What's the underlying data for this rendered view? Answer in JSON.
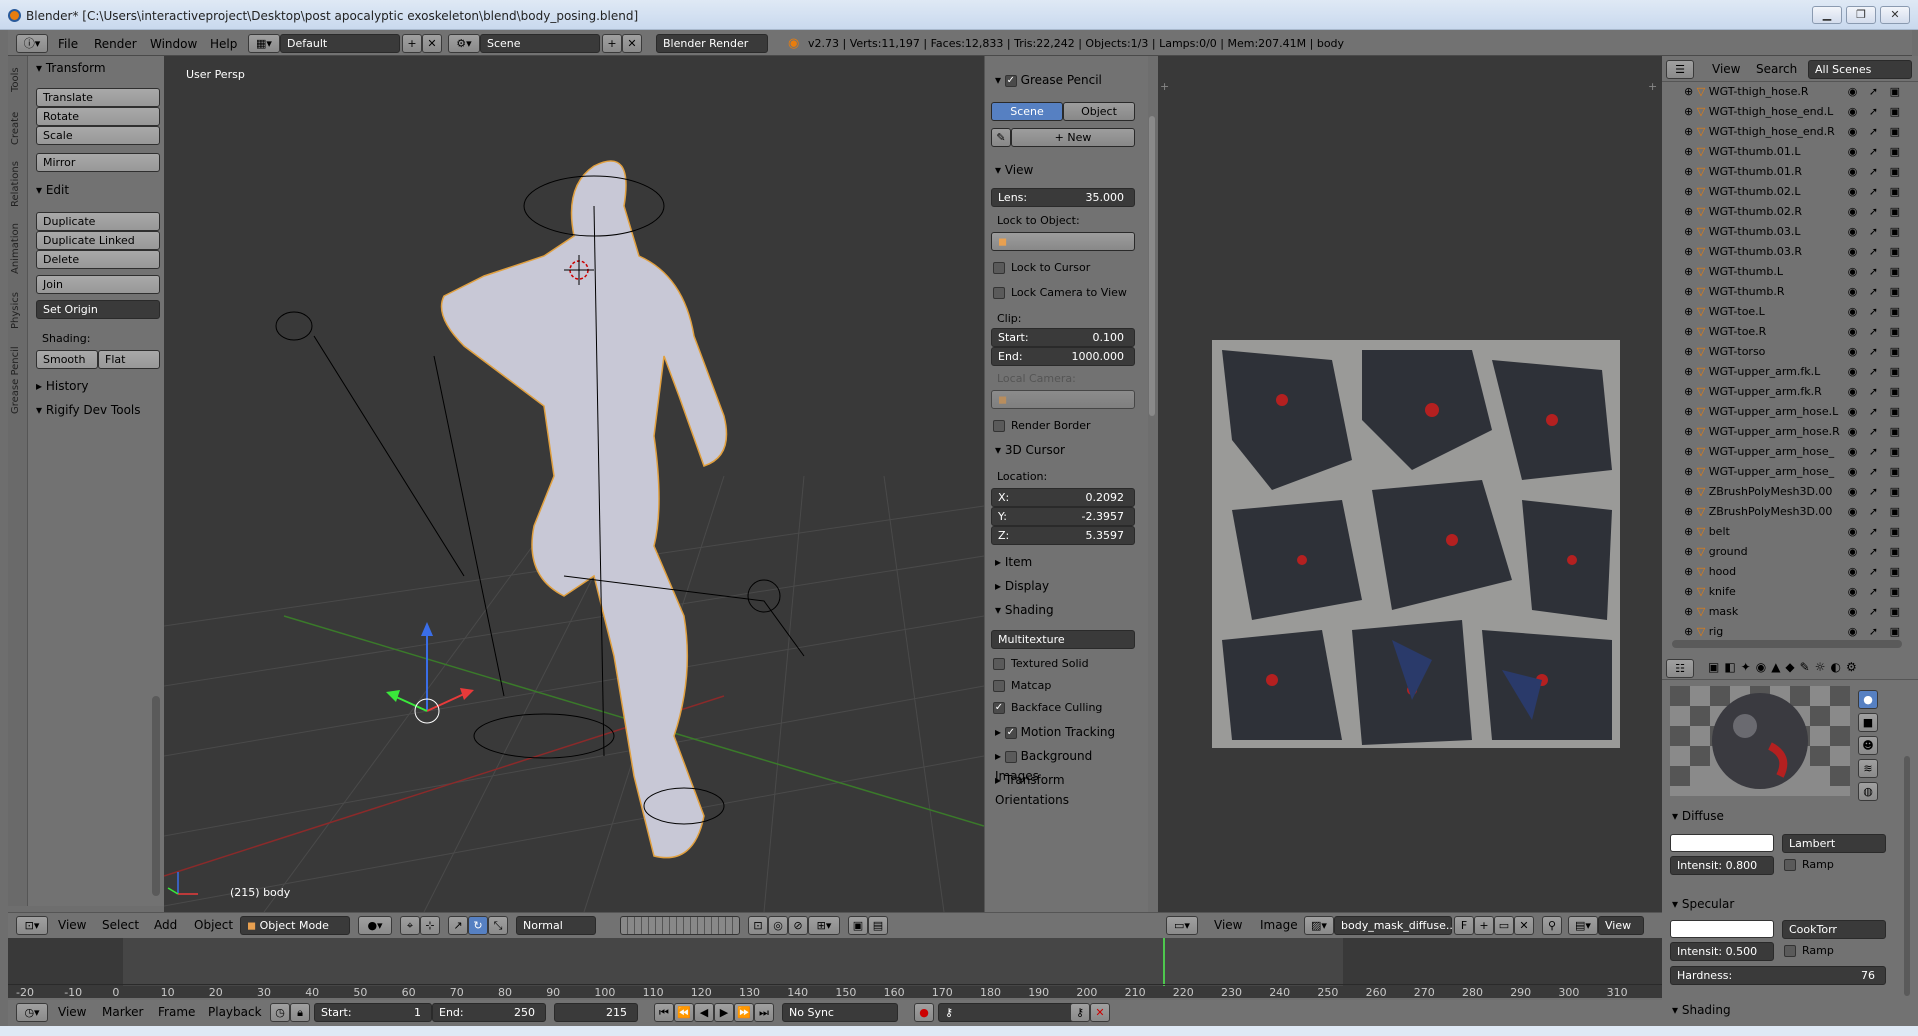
{
  "window": {
    "title": "Blender* [C:\\Users\\interactiveproject\\Desktop\\post apocalyptic exoskeleton\\blend\\body_posing.blend]",
    "minimize": "▁",
    "maximize": "❐",
    "close": "✕"
  },
  "infobar": {
    "menus": [
      "File",
      "Render",
      "Window",
      "Help"
    ],
    "layout": "Default",
    "scene": "Scene",
    "engine": "Blender Render",
    "stats": "v2.73 | Verts:11,197 | Faces:12,833 | Tris:22,242 | Objects:1/3 | Lamps:0/0 | Mem:207.41M | body"
  },
  "toolshelf": {
    "tabs": [
      "Tools",
      "Create",
      "Relations",
      "Animation",
      "Physics",
      "Grease Pencil"
    ],
    "transform_title": "Transform",
    "transform_buttons": [
      "Translate",
      "Rotate",
      "Scale"
    ],
    "mirror": "Mirror",
    "edit_title": "Edit",
    "edit_buttons": [
      "Duplicate",
      "Duplicate Linked",
      "Delete"
    ],
    "join": "Join",
    "set_origin": "Set Origin",
    "shading_label": "Shading:",
    "smooth": "Smooth",
    "flat": "Flat",
    "history": "History",
    "rigify": "Rigify Dev Tools"
  },
  "viewport": {
    "view_label": "User Persp",
    "object_label": "(215) body"
  },
  "n_panel": {
    "grease_pencil": "Grease Pencil",
    "scene_tab": "Scene",
    "object_tab": "Object",
    "new_btn": "New",
    "view_title": "View",
    "lens_label": "Lens:",
    "lens_value": "35.000",
    "lock_to_object": "Lock to Object:",
    "lock_to_cursor": "Lock to Cursor",
    "lock_camera": "Lock Camera to View",
    "clip_label": "Clip:",
    "start_label": "Start:",
    "start_value": "0.100",
    "end_label": "End:",
    "end_value": "1000.000",
    "local_camera": "Local Camera:",
    "render_border": "Render Border",
    "cursor_title": "3D Cursor",
    "location_label": "Location:",
    "x_label": "X:",
    "x_value": "0.2092",
    "y_label": "Y:",
    "y_value": "-2.3957",
    "z_label": "Z:",
    "z_value": "5.3597",
    "item": "Item",
    "display": "Display",
    "shading": "Shading",
    "multitexture": "Multitexture",
    "textured_solid": "Textured Solid",
    "matcap": "Matcap",
    "backface": "Backface Culling",
    "motion_tracking": "Motion Tracking",
    "background_images": "Background Images",
    "transform_orientations": "Transform Orientations"
  },
  "outliner": {
    "view": "View",
    "search": "Search",
    "all_scenes": "All Scenes",
    "items": [
      "WGT-thigh_hose.R",
      "WGT-thigh_hose_end.L",
      "WGT-thigh_hose_end.R",
      "WGT-thumb.01.L",
      "WGT-thumb.01.R",
      "WGT-thumb.02.L",
      "WGT-thumb.02.R",
      "WGT-thumb.03.L",
      "WGT-thumb.03.R",
      "WGT-thumb.L",
      "WGT-thumb.R",
      "WGT-toe.L",
      "WGT-toe.R",
      "WGT-torso",
      "WGT-upper_arm.fk.L",
      "WGT-upper_arm.fk.R",
      "WGT-upper_arm_hose.L",
      "WGT-upper_arm_hose.R",
      "WGT-upper_arm_hose_",
      "WGT-upper_arm_hose_",
      "ZBrushPolyMesh3D.00",
      "ZBrushPolyMesh3D.00",
      "belt",
      "ground",
      "hood",
      "knife",
      "mask",
      "rig"
    ]
  },
  "material": {
    "diffuse": "Diffuse",
    "lambert": "Lambert",
    "intensity_label": "Intensit:",
    "intensity_value": "0.800",
    "ramp": "Ramp",
    "specular": "Specular",
    "cooktorr": "CookTorr",
    "spec_intensity": "0.500",
    "hardness_label": "Hardness:",
    "hardness_value": "76",
    "shading": "Shading"
  },
  "header3d": {
    "menus": [
      "View",
      "Select",
      "Add",
      "Object"
    ],
    "mode": "Object Mode",
    "orientation": "Normal"
  },
  "header_img": {
    "menus": [
      "View",
      "Image"
    ],
    "image_name": "body_mask_diffuse....",
    "fake": "F",
    "view": "View"
  },
  "timeline": {
    "ticks": [
      "-20",
      "-10",
      "0",
      "10",
      "20",
      "30",
      "40",
      "50",
      "60",
      "70",
      "80",
      "90",
      "100",
      "110",
      "120",
      "130",
      "140",
      "150",
      "160",
      "170",
      "180",
      "190",
      "200",
      "210",
      "220",
      "230",
      "240",
      "250",
      "260",
      "270",
      "280",
      "290",
      "300",
      "310"
    ],
    "menus": [
      "View",
      "Marker",
      "Frame",
      "Playback"
    ],
    "start_label": "Start:",
    "start_value": "1",
    "end_label": "End:",
    "end_value": "250",
    "current": "215",
    "sync": "No Sync"
  },
  "colors": {
    "accent": "#5680c2",
    "panel": "#727272",
    "viewport": "#393939",
    "selection": "#f5a623"
  }
}
